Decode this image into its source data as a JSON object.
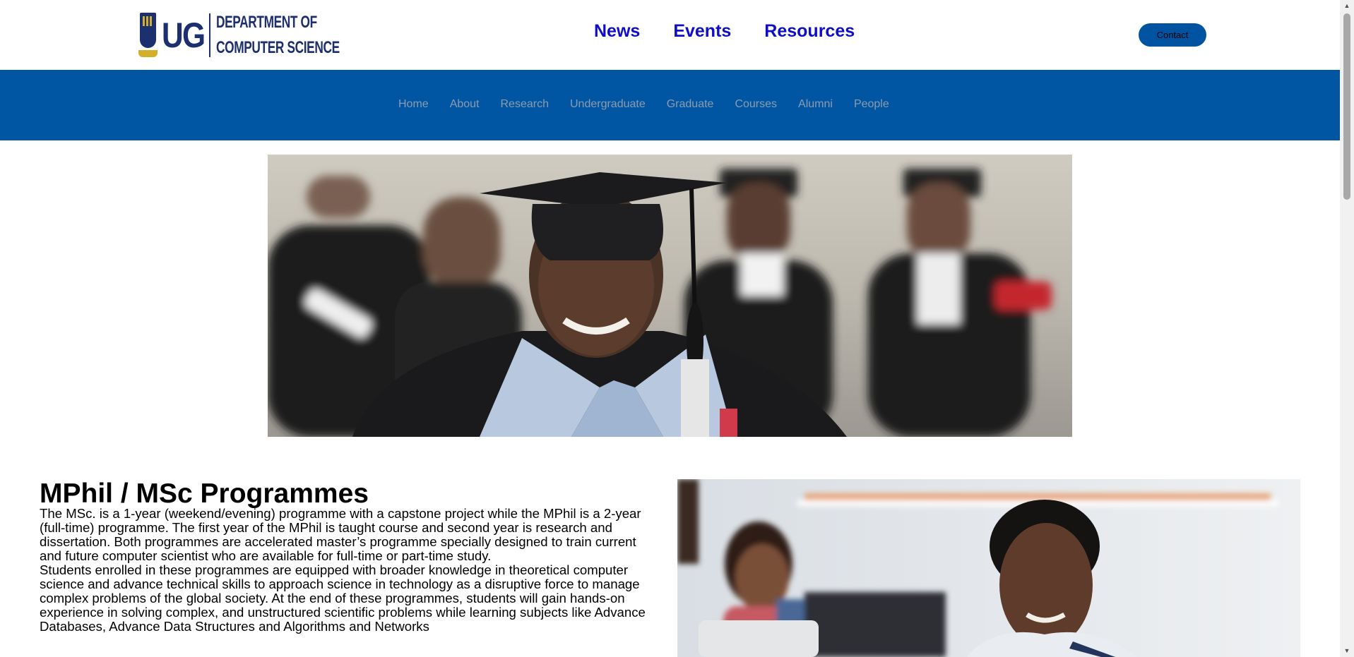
{
  "header": {
    "logo_mark": "UG",
    "logo_line1": "DEPARTMENT OF",
    "logo_line2": "COMPUTER SCIENCE",
    "top_nav": [
      "News",
      "Events",
      "Resources"
    ],
    "contact_label": "Contact"
  },
  "main_nav": {
    "items": [
      "Home",
      "About",
      "Research",
      "Undergraduate",
      "Graduate",
      "Courses",
      "Alumni",
      "People"
    ]
  },
  "hero": {
    "image": "graduate-in-cap-and-gown-photo"
  },
  "programme": {
    "title": "MPhil / MSc Programmes",
    "paragraph1": "The MSc. is a 1-year (weekend/evening) programme with a capstone project while the MPhil is a 2-year (full-time) programme. The first year of the MPhil is taught course and second year is research and dissertation. Both programmes are accelerated master’s programme specially designed to train current and future computer scientist who are available for full-time or part-time study.",
    "paragraph2": "Students enrolled in these programmes are equipped with broader knowledge in theoretical computer science and advance technical skills to approach science in technology as a disruptive force to manage complex problems of the global society. At the end of these programmes, students will gain hands-on experience in solving complex, and unstructured scientific problems while learning subjects like Advance Databases, Advance Data Structures and Algorithms and Networks",
    "side_image": "students-at-laptops-photo"
  },
  "colors": {
    "brand_navy": "#1c2f6e",
    "nav_band": "#0056a3",
    "top_nav_link": "#0e0ec8",
    "contact_button": "#0053a0",
    "nav_link": "#8d9cad"
  },
  "scrollbar": {
    "up_icon": "▲",
    "down_icon": "▼"
  }
}
